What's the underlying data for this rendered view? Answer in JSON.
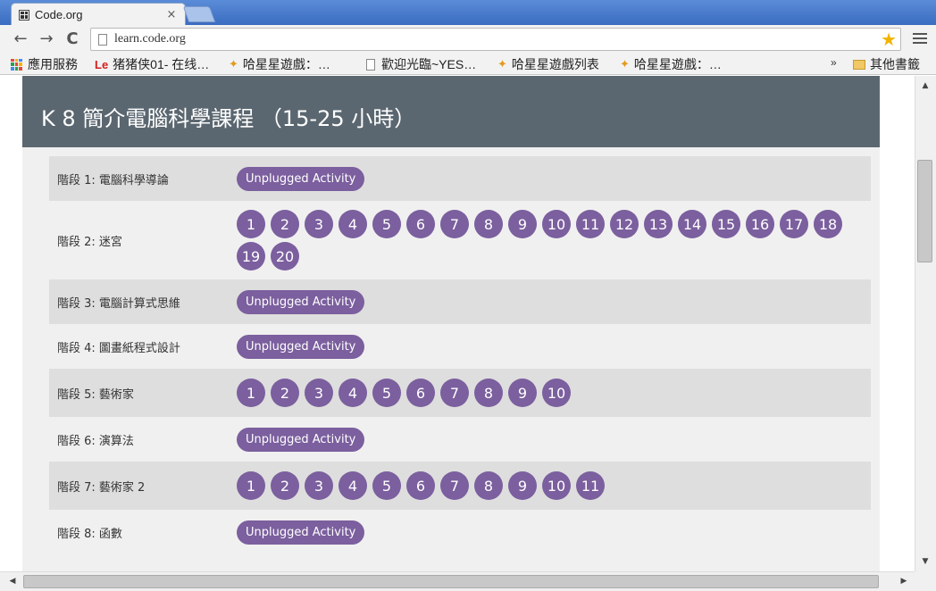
{
  "browser": {
    "tab_title": "Code.org",
    "tab_close": "×",
    "url": "learn.code.org",
    "back": "←",
    "forward": "→",
    "reload": "C",
    "star": "★",
    "bookmarks": [
      {
        "label": "應用服務",
        "icon": "apps-icon"
      },
      {
        "label": "猪猪侠01- 在线…",
        "icon": "le-icon"
      },
      {
        "label": "哈星星遊戲：…",
        "icon": "star-icon"
      },
      {
        "label": "歡迎光臨~YES…",
        "icon": "page-icon"
      },
      {
        "label": "哈星星遊戲列表",
        "icon": "star-icon"
      },
      {
        "label": "哈星星遊戲：…",
        "icon": "star-icon"
      }
    ],
    "bookmarks_overflow": "»",
    "other_bookmarks": "其他書籤",
    "apps_colors": [
      "#e24a3b",
      "#f6b400",
      "#3f8cf3",
      "#23a24d",
      "#e24a3b",
      "#f6b400",
      "#3f8cf3",
      "#23a24d",
      "#e24a3b"
    ]
  },
  "page": {
    "title": "K 8 簡介電腦科學課程 （15-25 小時）",
    "accent_color": "#7b5f9e",
    "header_color": "#5b6770",
    "stages": [
      {
        "label": "階段 1: 電腦科學導論",
        "type": "unplugged",
        "pill": "Unplugged Activity"
      },
      {
        "label": "階段 2: 迷宮",
        "type": "levels",
        "levels": [
          "1",
          "2",
          "3",
          "4",
          "5",
          "6",
          "7",
          "8",
          "9",
          "10",
          "11",
          "12",
          "13",
          "14",
          "15",
          "16",
          "17",
          "18",
          "19",
          "20"
        ]
      },
      {
        "label": "階段 3: 電腦計算式思維",
        "type": "unplugged",
        "pill": "Unplugged Activity"
      },
      {
        "label": "階段 4: 圖畫紙程式設計",
        "type": "unplugged",
        "pill": "Unplugged Activity"
      },
      {
        "label": "階段 5: 藝術家",
        "type": "levels",
        "levels": [
          "1",
          "2",
          "3",
          "4",
          "5",
          "6",
          "7",
          "8",
          "9",
          "10"
        ]
      },
      {
        "label": "階段 6: 演算法",
        "type": "unplugged",
        "pill": "Unplugged Activity"
      },
      {
        "label": "階段 7: 藝術家 2",
        "type": "levels",
        "levels": [
          "1",
          "2",
          "3",
          "4",
          "5",
          "6",
          "7",
          "8",
          "9",
          "10",
          "11"
        ]
      },
      {
        "label": "階段 8: 函數",
        "type": "unplugged",
        "pill": "Unplugged Activity"
      }
    ]
  },
  "scrollbars": {
    "up": "▲",
    "down": "▼",
    "left": "◀",
    "right": "▶"
  }
}
